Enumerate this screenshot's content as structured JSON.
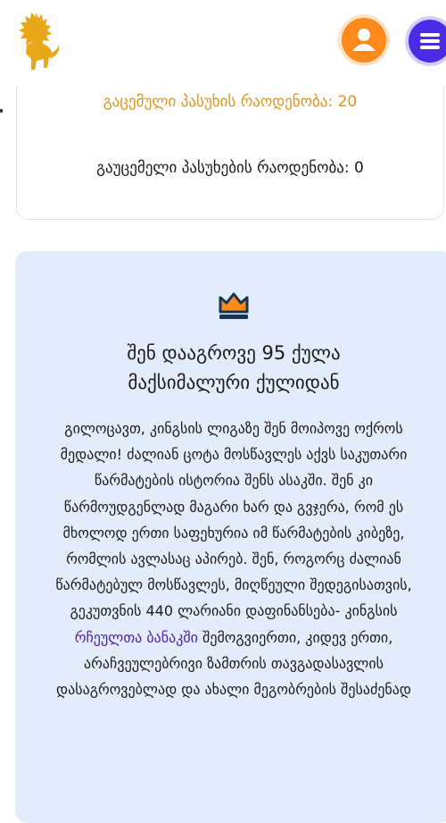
{
  "header": {
    "logo_icon": "golden-lion-logo",
    "profile_icon": "user-icon",
    "menu_icon": "hamburger-menu-icon",
    "colors": {
      "profile": "#ff8a1c",
      "menu": "#4b2be6",
      "logo": "#e8a81a"
    }
  },
  "answers": {
    "answered_text": "გაცემული პასუხის რაოდენობა: 20",
    "unanswered_text": "გაუცემელი პასუხების რაოდენობა: 0",
    "colors": {
      "answered": "#e0961c"
    }
  },
  "result": {
    "crown_icon": "crown-icon",
    "score_line1": "შენ დააგროვე 95 ქულა",
    "score_line2": "მაქსიმალური ქულიდან",
    "message_part1": "გილოცავთ, კინგსის ლიგაზე შენ მოიპოვე ოქროს მედალი! ძალიან ცოტა მოსწავლეს აქვს საკუთარი წარმატების ისტორია შენს ასაკში. შენ კი წარმოუდგენლად მაგარი ხარ და გვჯერა, რომ ეს მხოლოდ ერთი საფეხურია იმ წარმატების კიბეზე, რომლის ავლასაც აპირებ. შენ, როგორც ძალიან წარმატებულ მოსწავლეს, მიღწეული შედეგისათვის, გეკუთვნის 440 ლარიანი დაფინანსება- კინგსის ",
    "bank_link": "რჩეულთა ბანაკში",
    "message_part2": " შემოგვიერთი, კიდევ ერთი, არაჩვეულებრივი ზამთრის თავგადასავლის დასაგროვებლად და ახალი მეგობრების შესაძენად",
    "colors": {
      "background": "#e3ecfb",
      "link": "#4a1ea6"
    }
  }
}
